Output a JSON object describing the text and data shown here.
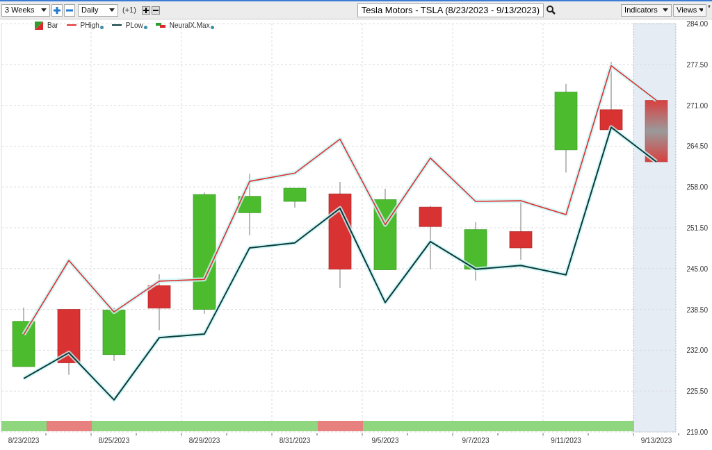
{
  "toolbar": {
    "period": "3 Weeks",
    "interval": "Daily",
    "offset": "(+1)",
    "symbol": "Tesla Motors - TSLA (8/23/2023 - 9/13/2023)",
    "indicators": "Indicators",
    "views": "Views",
    "views_mark": "*"
  },
  "legend": [
    {
      "kind": "bar",
      "label": "Bar"
    },
    {
      "kind": "series"
    },
    {
      "kind": "series"
    },
    {
      "kind": "step",
      "label": "NeuralX.Max"
    }
  ],
  "chart": {
    "chart_data": {
      "type": "line",
      "grid": true,
      "bands": [
        {
          "axis": "x",
          "from": "9/13/2023",
          "to": "9/13/2023"
        }
      ],
      "ylim": [
        219,
        284
      ],
      "yticks": [
        {
          "value": 284,
          "label": "284.00"
        },
        {
          "value": 277.5,
          "label": "277.50"
        },
        {
          "value": 271,
          "label": "271.00"
        },
        {
          "value": 264.5,
          "label": "264.50"
        },
        {
          "value": 258,
          "label": "258.00"
        },
        {
          "value": 251.5,
          "label": "251.50"
        },
        {
          "value": 245,
          "label": "245.00"
        },
        {
          "value": 238.5,
          "label": "238.50"
        },
        {
          "value": 232,
          "label": "232.00"
        },
        {
          "value": 225.5,
          "label": "225.50"
        },
        {
          "value": 219,
          "label": "219.00"
        }
      ],
      "categories": [
        "8/23/2023",
        null,
        "8/25/2023",
        null,
        "8/29/2023",
        null,
        "8/31/2023",
        null,
        "9/5/2023",
        null,
        "9/7/2023",
        null,
        "9/11/2023",
        null,
        "9/13/2023"
      ],
      "series": [
        {
          "name": "PHigh",
          "color": "#e03030",
          "values": [
            234.5,
            246.3,
            238.1,
            243.0,
            243.3,
            258.9,
            260.2,
            265.6,
            252.0,
            262.6,
            255.7,
            255.8,
            253.6,
            277.3,
            271.8
          ]
        },
        {
          "name": "PLow",
          "color": "#0b3a3a",
          "values": [
            227.5,
            231.6,
            224.1,
            234.0,
            234.6,
            248.3,
            249.1,
            254.6,
            239.6,
            249.3,
            244.9,
            245.5,
            244.0,
            267.5,
            262.0
          ]
        }
      ]
    },
    "signals": [
      {
        "color": "#8fd67e"
      },
      {
        "color": "#e88080"
      },
      {
        "color": "#8fd67e"
      },
      {
        "color": "#8fd67e"
      },
      {
        "color": "#8fd67e"
      },
      {
        "color": "#8fd67e"
      },
      {
        "color": "#8fd67e"
      },
      {
        "color": "#e88080"
      },
      {
        "color": "#8fd67e"
      },
      {
        "color": "#8fd67e"
      },
      {
        "color": "#8fd67e"
      },
      {
        "color": "#8fd67e"
      },
      {
        "color": "#8fd67e"
      },
      {
        "color": "#8fd67e"
      }
    ]
  }
}
